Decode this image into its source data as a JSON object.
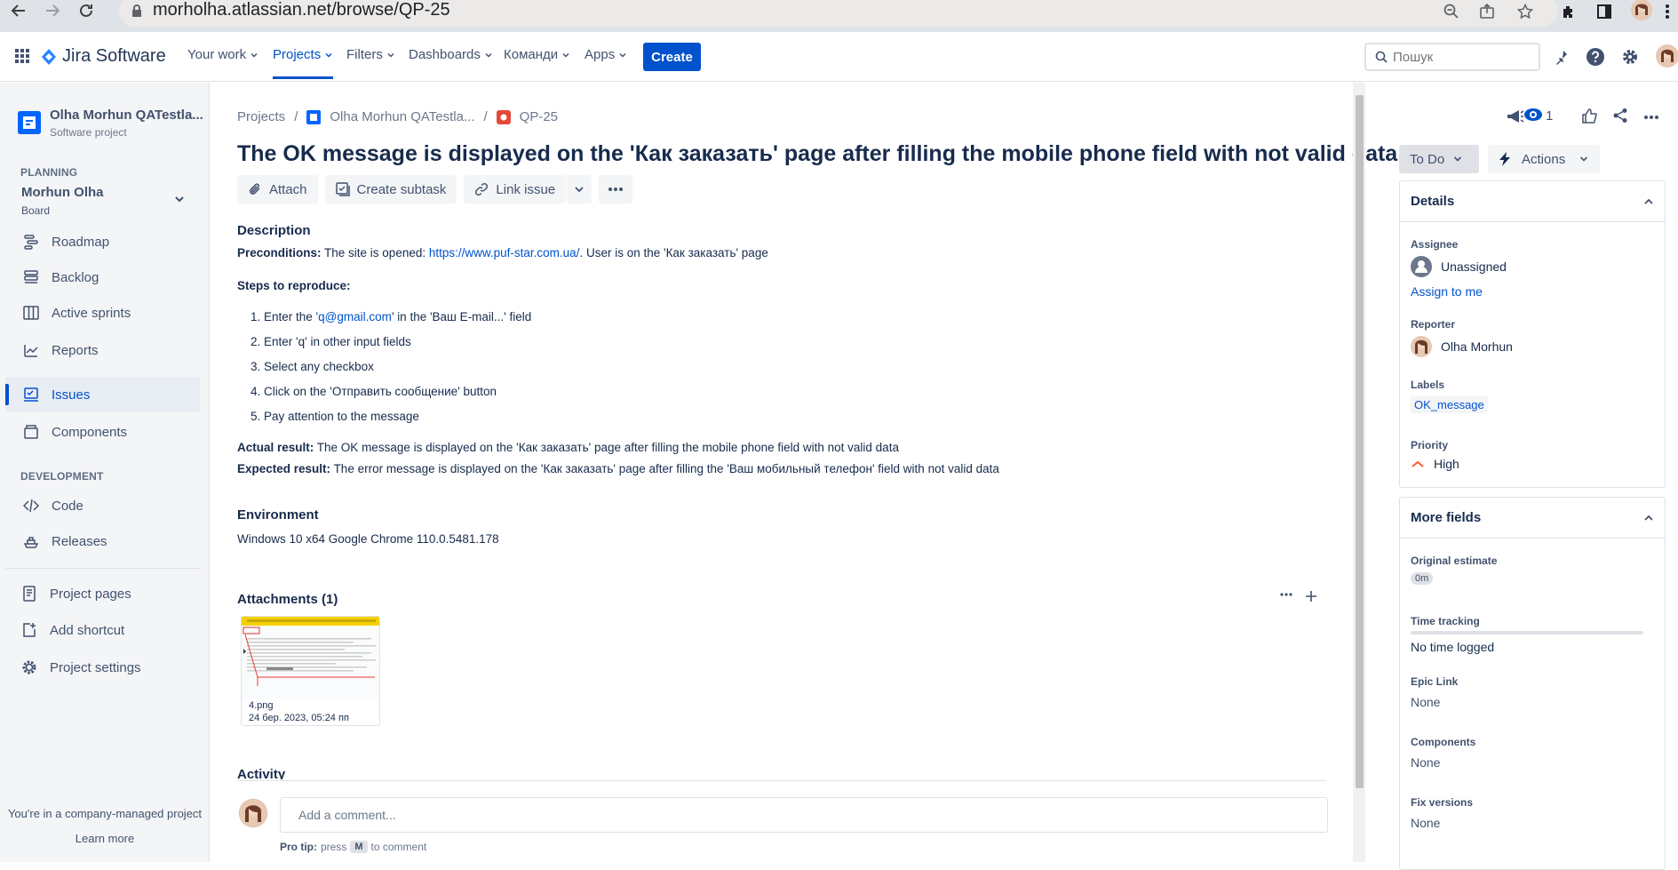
{
  "browser": {
    "url": "morholha.atlassian.net/browse/QP-25"
  },
  "topnav": {
    "product": "Jira Software",
    "items": [
      {
        "label": "Your work"
      },
      {
        "label": "Projects"
      },
      {
        "label": "Filters"
      },
      {
        "label": "Dashboards"
      },
      {
        "label": "Команди"
      },
      {
        "label": "Apps"
      }
    ],
    "create": "Create",
    "search_placeholder": "Пошук"
  },
  "sidebar": {
    "project_name": "Olha Morhun QATestla...",
    "project_type": "Software project",
    "planning_title": "PLANNING",
    "board_name": "Morhun Olha",
    "board_sub": "Board",
    "planning_items": [
      {
        "label": "Roadmap",
        "icon": "roadmap-icon"
      },
      {
        "label": "Backlog",
        "icon": "backlog-icon"
      },
      {
        "label": "Active sprints",
        "icon": "board-icon"
      },
      {
        "label": "Reports",
        "icon": "reports-icon"
      },
      {
        "label": "Issues",
        "icon": "issues-icon"
      },
      {
        "label": "Components",
        "icon": "components-icon"
      }
    ],
    "development_title": "DEVELOPMENT",
    "development_items": [
      {
        "label": "Code",
        "icon": "code-icon"
      },
      {
        "label": "Releases",
        "icon": "releases-icon"
      }
    ],
    "bottom_items": [
      {
        "label": "Project pages",
        "icon": "page-icon"
      },
      {
        "label": "Add shortcut",
        "icon": "add-shortcut-icon"
      },
      {
        "label": "Project settings",
        "icon": "gear-icon"
      }
    ],
    "footer_text": "You're in a company-managed project",
    "learn_more": "Learn more"
  },
  "issue": {
    "breadcrumb_projects": "Projects",
    "breadcrumb_project": "Olha Morhun QATestla...",
    "breadcrumb_key": "QP-25",
    "title": "The OK message is displayed on the 'Как заказать' page after filling the mobile phone field with not valid data",
    "toolbar": {
      "attach": "Attach",
      "create_subtask": "Create subtask",
      "link_issue": "Link issue"
    },
    "description_label": "Description",
    "preconditions_label": "Preconditions:",
    "preconditions_text_1": "The site is opened:",
    "preconditions_link": "https://www.puf-star.com.ua/",
    "preconditions_text_2": ". User is on the 'Как заказать' page",
    "steps_label": "Steps to reproduce:",
    "step_1_pre": "1. Enter the ",
    "step_1_link": "'q@gmail.com",
    "step_1_post": "' in the 'Ваш E-mail...' field",
    "steps": [
      "2. Enter 'q' in other input fields",
      "3. Select any checkbox",
      "4. Click on the 'Отправить сообщение' button",
      "5. Pay attention to the message"
    ],
    "actual_label": "Actual result:",
    "actual_text": "The OK message is displayed on the 'Как заказать' page after filling the mobile phone field with not valid data",
    "expected_label": "Expected result:",
    "expected_text": "The error message is displayed on the 'Как заказать' page after filling the 'Ваш мобильный телефон' field with not valid data",
    "environment_label": "Environment",
    "environment_text": "Windows 10 x64 Google Chrome 110.0.5481.178",
    "attachments_title": "Attachments (1)",
    "attachment_name": "4.png",
    "attachment_date": "24 бер. 2023, 05:24 пп",
    "activity_title": "Activity",
    "comment_placeholder": "Add a comment...",
    "pro_tip_label": "Pro tip:",
    "pro_tip_press": "press",
    "pro_tip_key": "M",
    "pro_tip_rest": "to comment"
  },
  "right_panel": {
    "watch_count": "1",
    "status": "To Do",
    "actions": "Actions",
    "details_title": "Details",
    "assignee_label": "Assignee",
    "assignee_value": "Unassigned",
    "assign_to_me": "Assign to me",
    "reporter_label": "Reporter",
    "reporter_value": "Olha Morhun",
    "labels_label": "Labels",
    "labels_value": "OK_message",
    "priority_label": "Priority",
    "priority_value": "High",
    "more_fields_title": "More fields",
    "original_estimate_label": "Original estimate",
    "original_estimate_value": "0m",
    "time_tracking_label": "Time tracking",
    "time_tracking_value": "No time logged",
    "epic_link_label": "Epic Link",
    "epic_link_value": "None",
    "components_label": "Components",
    "components_value": "None",
    "fix_versions_label": "Fix versions",
    "fix_versions_value": "None"
  },
  "colors": {
    "brand": "#0052cc",
    "priority_high": "#ff5630"
  }
}
